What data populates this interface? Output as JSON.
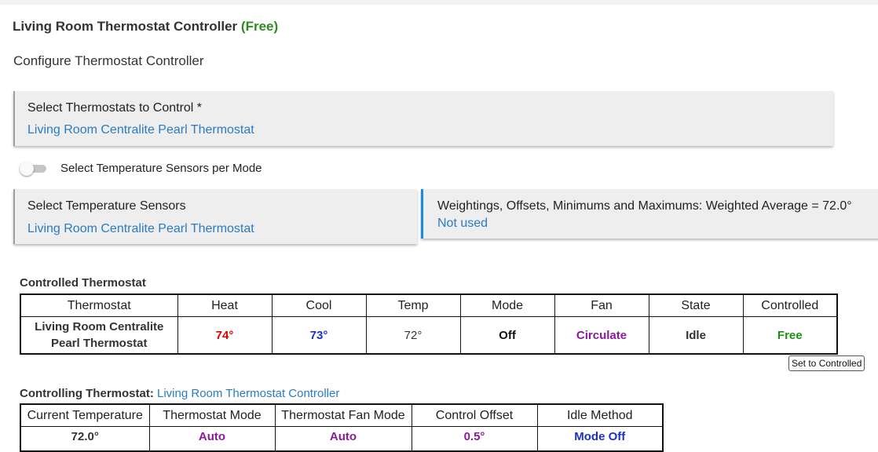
{
  "app": {
    "title": "Living Room Thermostat Controller",
    "badge": "(Free)",
    "subtitle": "Configure Thermostat Controller"
  },
  "thermostat_select": {
    "label": "Select Thermostats to Control *",
    "value": "Living Room Centralite Pearl Thermostat"
  },
  "sensor_toggle": {
    "label": "Select Temperature Sensors per Mode",
    "on": false
  },
  "sensor_select": {
    "label": "Select Temperature Sensors",
    "value": "Living Room Centralite Pearl Thermostat"
  },
  "weightings": {
    "label": "Weightings, Offsets, Minimums and Maximums: Weighted Average = 72.0°",
    "value": "Not used"
  },
  "controlled": {
    "heading": "Controlled Thermostat",
    "columns": [
      "Thermostat",
      "Heat",
      "Cool",
      "Temp",
      "Mode",
      "Fan",
      "State",
      "Controlled"
    ],
    "row": {
      "thermostat_line1": "Living Room Centralite",
      "thermostat_line2": "Pearl Thermostat",
      "heat": "74°",
      "cool": "73°",
      "temp": "72°",
      "mode": "Off",
      "fan": "Circulate",
      "state": "Idle",
      "controlled": "Free"
    },
    "tooltip": "Set to Controlled"
  },
  "controlling": {
    "heading": "Controlling Thermostat:",
    "heading_link": "Living Room Thermostat Controller",
    "columns": [
      "Current Temperature",
      "Thermostat Mode",
      "Thermostat Fan Mode",
      "Control Offset",
      "Idle Method"
    ],
    "row": {
      "current_temperature": "72.0°",
      "thermostat_mode": "Auto",
      "fan_mode": "Auto",
      "control_offset": "0.5°",
      "idle_method": "Mode Off"
    }
  },
  "colors": {
    "accent_blue": "#2a7bc0",
    "free_green": "#2e8b1e",
    "heat_red": "#e00000",
    "cool_blue": "#1a33c4",
    "mode_purple": "#8a1a9a"
  }
}
